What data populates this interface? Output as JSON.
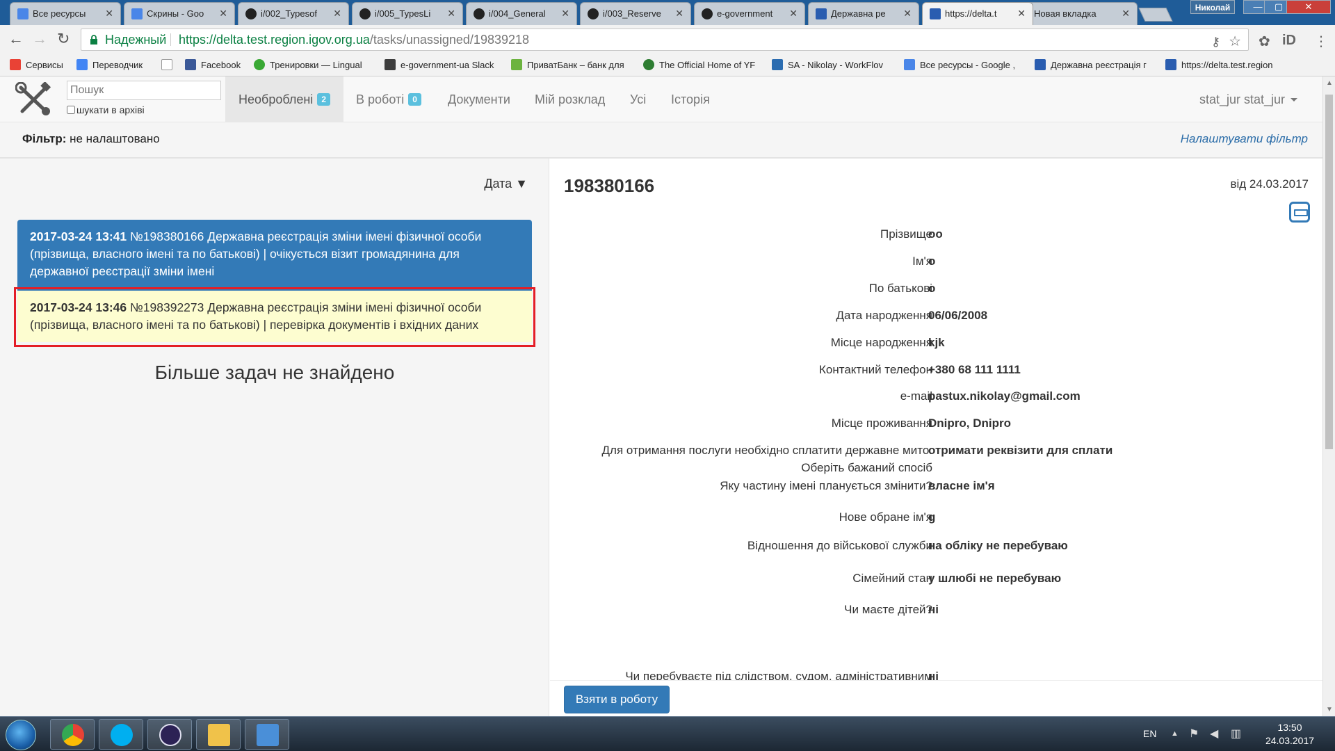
{
  "browser": {
    "tabs": [
      {
        "label": "Все ресурсы",
        "icon": "docs-icon",
        "color": "#4a86e8"
      },
      {
        "label": "Скрины - Goo",
        "icon": "docs-icon",
        "color": "#4a86e8"
      },
      {
        "label": "i/002_Typesof",
        "icon": "github-icon",
        "color": "#222222"
      },
      {
        "label": "i/005_TypesLi",
        "icon": "github-icon",
        "color": "#222222"
      },
      {
        "label": "i/004_General",
        "icon": "github-icon",
        "color": "#222222"
      },
      {
        "label": "i/003_Reserve",
        "icon": "github-icon",
        "color": "#222222"
      },
      {
        "label": "e-government",
        "icon": "github-icon",
        "color": "#222222"
      },
      {
        "label": "Державна ре",
        "icon": "trident-icon",
        "color": "#2a5db0"
      },
      {
        "label": "https://delta.t",
        "icon": "trident-icon",
        "color": "#2a5db0"
      },
      {
        "label": "Новая вкладка",
        "icon": "",
        "color": ""
      }
    ],
    "profile_name": "Николай",
    "window_buttons": {
      "minimize": "—",
      "maximize": "▢",
      "close": "✕"
    },
    "omnibox": {
      "secure_label": "Надежный",
      "url_origin": "https://delta.test.region.igov.org.ua",
      "url_path": "/tasks/unassigned/19839218"
    },
    "bookmarks": [
      {
        "label": "Сервисы",
        "icon": "apps-icon",
        "color": "#e94235"
      },
      {
        "label": "Переводчик",
        "icon": "translate-icon",
        "color": "#4285f4"
      },
      {
        "label": "",
        "icon": "page-icon",
        "color": "#999999"
      },
      {
        "label": "Facebook",
        "icon": "facebook-icon",
        "color": "#3b5998"
      },
      {
        "label": "Тренировки — Lingual",
        "icon": "lingualeo-icon",
        "color": "#3aa935"
      },
      {
        "label": "e-government-ua Slack",
        "icon": "slack-icon",
        "color": "#3d3d3d"
      },
      {
        "label": "ПриватБанк – банк для",
        "icon": "privat-icon",
        "color": "#6cb33f"
      },
      {
        "label": "The Official Home of YF",
        "icon": "yf-icon",
        "color": "#2e7d32"
      },
      {
        "label": "SA - Nikolay - WorkFlov",
        "icon": "workflow-icon",
        "color": "#2b6cb0"
      },
      {
        "label": "Все ресурсы - Google ,",
        "icon": "docs-icon",
        "color": "#4a86e8"
      },
      {
        "label": "Державна реєстрація г",
        "icon": "trident-icon",
        "color": "#2a5db0"
      },
      {
        "label": "https://delta.test.region",
        "icon": "trident-icon",
        "color": "#2a5db0"
      }
    ]
  },
  "app": {
    "search_placeholder": "Пошук",
    "archive_label": "шукати в архіві",
    "nav": [
      {
        "label": "Необроблені",
        "badge": "2"
      },
      {
        "label": "В роботі",
        "badge": "0"
      },
      {
        "label": "Документи",
        "badge": ""
      },
      {
        "label": "Мій розклад",
        "badge": ""
      },
      {
        "label": "Усі",
        "badge": ""
      },
      {
        "label": "Історія",
        "badge": ""
      }
    ],
    "user": "stat_jur stat_jur",
    "filter": {
      "label": "Фільтр:",
      "value": "не налаштовано",
      "configure": "Налаштувати фільтр"
    },
    "sort_label": "Дата ▼",
    "tasks": [
      {
        "head": "2017-03-24 13:41",
        "text": "№198380166 Державна реєстрація зміни імені фізичної особи (прізвища, власного імені та по батькові) | очікується візит громадянина для державної реєстрації зміни імені"
      },
      {
        "head": "2017-03-24 13:46",
        "text": "№198392273 Державна реєстрація зміни імені фізичної особи (прізвища, власного імені та по батькові) | перевірка документів і вхідних даних"
      }
    ],
    "no_more": "Більше задач не знайдено",
    "detail": {
      "number": "198380166",
      "date": "від 24.03.2017",
      "fields": [
        {
          "label": "Прізвище",
          "value": "оо"
        },
        {
          "label": "Ім'я",
          "value": "о"
        },
        {
          "label": "По батькові",
          "value": "о"
        },
        {
          "label": "Дата народження",
          "value": "06/06/2008"
        },
        {
          "label": "Місце народження",
          "value": "kjk"
        },
        {
          "label": "Контактний телефон",
          "value": "+380 68 111 1111"
        },
        {
          "label": "e-mail",
          "value": "pastux.nikolay@gmail.com"
        },
        {
          "label": "Місце проживання",
          "value": "Dnipro, Dnipro"
        },
        {
          "label": "Для отримання послуги необхідно сплатити державне мито. Оберіть бажаний спосіб",
          "value": "отримати реквізити для сплати"
        },
        {
          "label": "Яку частину імені планується змінити?",
          "value": "власне ім'я"
        },
        {
          "label": "Нове обране ім'я",
          "value": "g"
        },
        {
          "label": "Відношення до військової служби",
          "value": "на обліку не перебуваю"
        },
        {
          "label": "Сімейний стан",
          "value": "у шлюбі не перебуваю"
        },
        {
          "label": "Чи маєте дітей?",
          "value": "ні"
        },
        {
          "label": "Чи перебуваєте під слідством, судом, адміністративним",
          "value": "ні"
        }
      ],
      "take_button": "Взяти в роботу"
    }
  },
  "taskbar": {
    "apps": [
      {
        "name": "chrome",
        "icon": "chrome-icon",
        "color": "#e94235"
      },
      {
        "name": "skype",
        "icon": "skype-icon",
        "color": "#00aff0"
      },
      {
        "name": "eclipse",
        "icon": "eclipse-icon",
        "color": "#2c2255"
      },
      {
        "name": "explorer",
        "icon": "folder-icon",
        "color": "#f0c24a"
      },
      {
        "name": "photos",
        "icon": "image-viewer-icon",
        "color": "#4a8fd8"
      }
    ],
    "lang": "EN",
    "time": "13:50",
    "date": "24.03.2017"
  }
}
